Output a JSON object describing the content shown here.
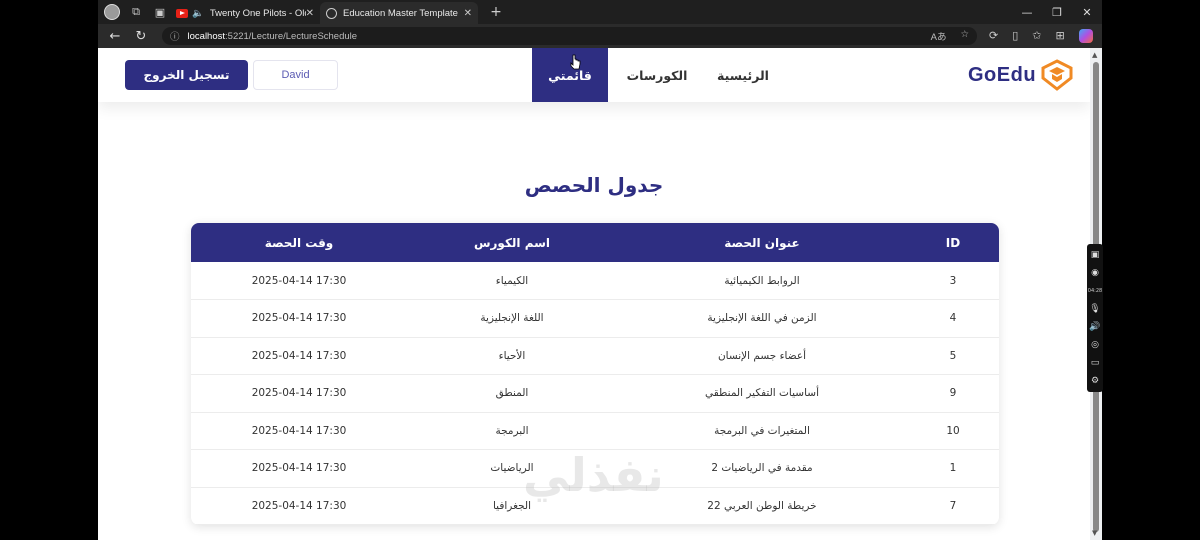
{
  "browser": {
    "tabs": [
      {
        "label": "Twenty One Pilots - Oldies S",
        "icon": "youtube-icon",
        "active": false
      },
      {
        "label": "Education Master Template",
        "icon": "globe-icon",
        "active": true
      }
    ],
    "url_host": "localhost",
    "url_path": ":5221/Lecture/LectureSchedule"
  },
  "navbar": {
    "logout_label": "تسجيل الخروج",
    "user_name": "David",
    "menu": {
      "my_list": "قائمتي",
      "courses": "الكورسات",
      "home": "الرئيسية"
    },
    "logo_text": "GoEdu",
    "accent_color": "#2e2e82",
    "logo_icon_color": "#f08a24"
  },
  "main": {
    "title": "جدول الحصص",
    "table": {
      "headers": [
        "ID",
        "عنوان الحصة",
        "اسم الكورس",
        "وقت الحصة"
      ],
      "rows": [
        [
          "3",
          "الروابط الكيميائية",
          "الكيمياء",
          "2025-04-14 17:30"
        ],
        [
          "4",
          "الزمن في اللغة الإنجليزية",
          "اللغة الإنجليزية",
          "2025-04-14 17:30"
        ],
        [
          "5",
          "أعضاء جسم الإنسان",
          "الأحياء",
          "2025-04-14 17:30"
        ],
        [
          "9",
          "أساسيات التفكير المنطقي",
          "المنطق",
          "2025-04-14 17:30"
        ],
        [
          "10",
          "المتغيرات في البرمجة",
          "البرمجة",
          "2025-04-14 17:30"
        ],
        [
          "1",
          "مقدمة في الرياضيات 2",
          "الرياضيات",
          "2025-04-14 17:30"
        ],
        [
          "7",
          "خريطة الوطن العربي 22",
          "الجغرافيا",
          "2025-04-14 17:30"
        ]
      ]
    }
  },
  "watermark": "نفذلي",
  "recorder": {
    "time": "04:28"
  }
}
